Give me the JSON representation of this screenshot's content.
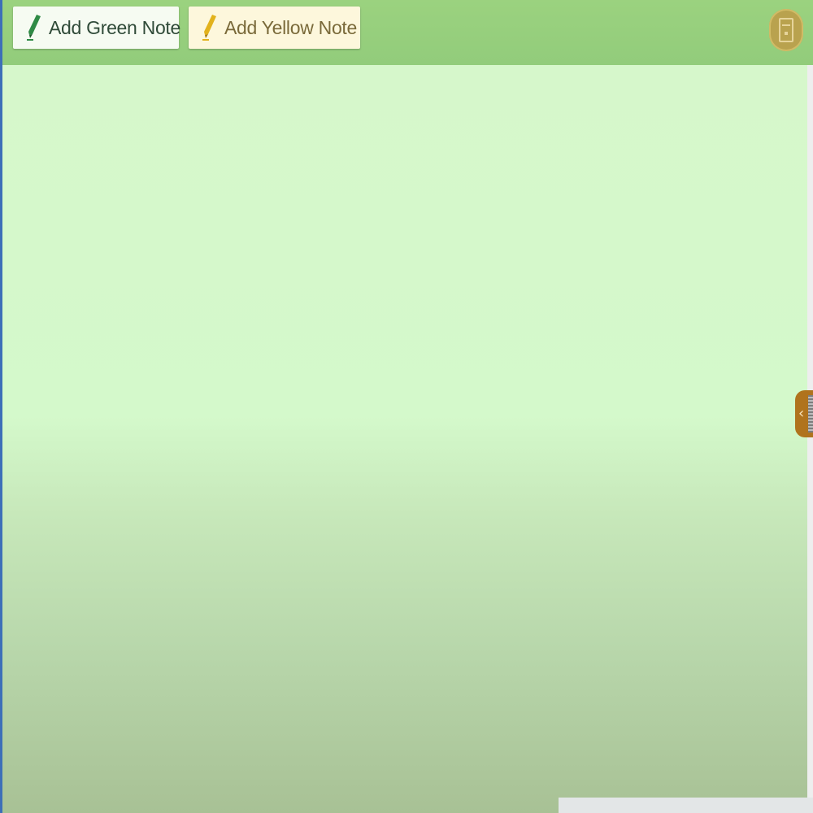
{
  "toolbar": {
    "add_green_note_label": "Add Green Note",
    "add_yellow_note_label": "Add Yellow Note",
    "green_pen_icon": "green-pen-icon",
    "yellow_pen_icon": "yellow-pen-icon",
    "menu_icon": "document-icon"
  },
  "side_panel": {
    "toggle_icon": "chevron-left-icon",
    "toggle_glyph": "‹"
  },
  "colors": {
    "toolbar_bg": "#94cd7c",
    "canvas_top": "#d5f8cb",
    "canvas_bottom": "#a8c195",
    "green_note_bg": "#f6fbf2",
    "yellow_note_bg": "#fdf7dc",
    "menu_button": "#b9a24e",
    "panel_toggle": "#b0731d"
  }
}
